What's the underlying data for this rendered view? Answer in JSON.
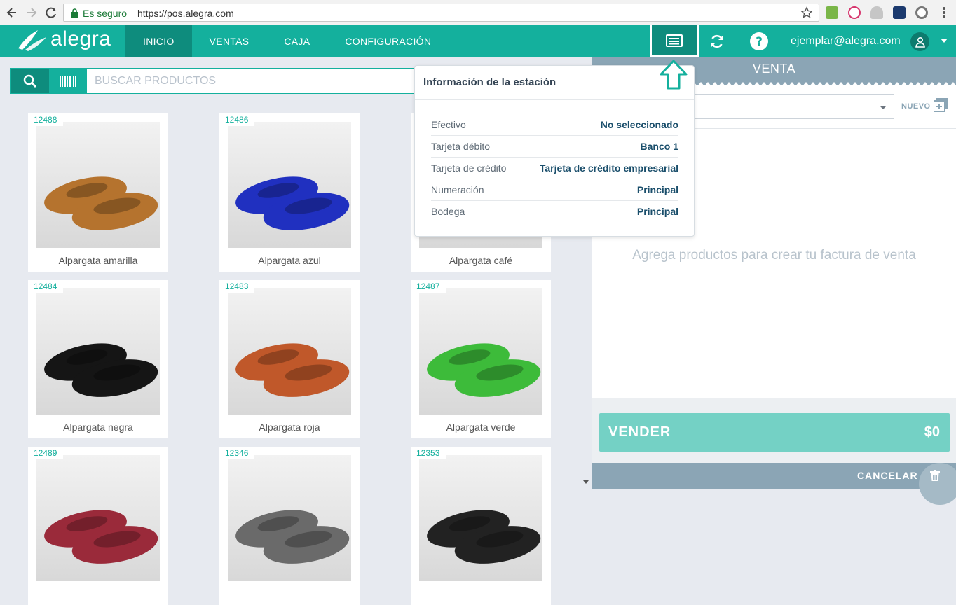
{
  "browser": {
    "secure_label": "Es seguro",
    "url": "https://pos.alegra.com"
  },
  "app": {
    "logo_text": "alegra",
    "nav": [
      "INICIO",
      "VENTAS",
      "CAJA",
      "CONFIGURACIÓN"
    ],
    "active_nav": "INICIO",
    "user_email": "ejemplar@alegra.com"
  },
  "search": {
    "placeholder": "BUSCAR PRODUCTOS"
  },
  "products": [
    {
      "code": "12488",
      "name": "Alpargata amarilla",
      "color": "#b5732e"
    },
    {
      "code": "12486",
      "name": "Alpargata azul",
      "color": "#2030c0"
    },
    {
      "code": "",
      "name": "Alpargata café",
      "color": "#9a3f14"
    },
    {
      "code": "12484",
      "name": "Alpargata negra",
      "color": "#151515"
    },
    {
      "code": "12483",
      "name": "Alpargata roja",
      "color": "#c0582a"
    },
    {
      "code": "12487",
      "name": "Alpargata verde",
      "color": "#3dbb3a"
    },
    {
      "code": "12489",
      "name": "",
      "color": "#9a2a3a"
    },
    {
      "code": "12346",
      "name": "",
      "color": "#6a6a6a"
    },
    {
      "code": "12353",
      "name": "",
      "color": "#222222"
    }
  ],
  "sale": {
    "title": "VENTA",
    "new_label": "NUEVO",
    "empty_message": "Agrega productos para crear tu factura de venta",
    "sell_label": "VENDER",
    "total": "$0",
    "cancel_label": "CANCELAR"
  },
  "station_info": {
    "title": "Información de la estación",
    "rows": [
      {
        "label": "Efectivo",
        "value": "No seleccionado"
      },
      {
        "label": "Tarjeta débito",
        "value": "Banco 1"
      },
      {
        "label": "Tarjeta de crédito",
        "value": "Tarjeta de crédito empresarial"
      },
      {
        "label": "Numeración",
        "value": "Principal"
      },
      {
        "label": "Bodega",
        "value": "Principal"
      }
    ]
  },
  "colors": {
    "brand": "#14b09d",
    "brand_dark": "#0e8c7d",
    "panel_header": "#8ba5b5",
    "sell_button": "#74d1c5"
  }
}
